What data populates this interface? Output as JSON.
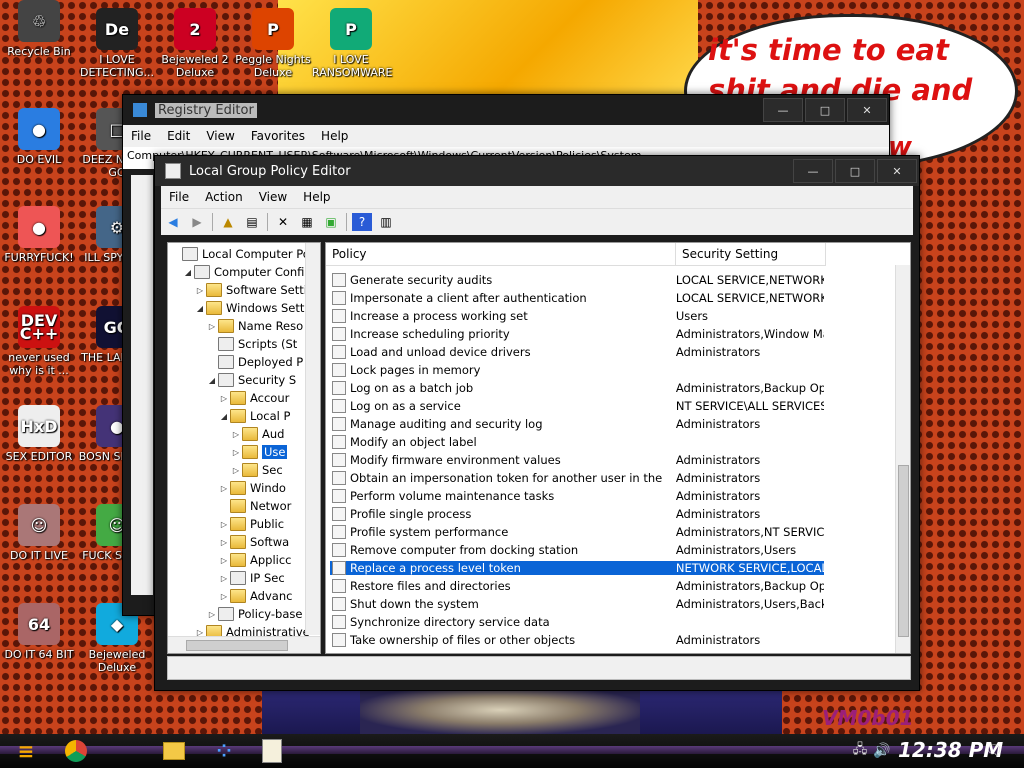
{
  "desktop": {
    "speech_text": "it's time to eat shit and die and chew",
    "speech_tail": "w",
    "logo": "VM0b01",
    "icons": [
      {
        "label": "Recycle Bin",
        "glyph": "♲",
        "color": "#444"
      },
      {
        "label": "I LOVE DETECTING...",
        "glyph": "De",
        "color": "#222"
      },
      {
        "label": "Bejeweled 2 Deluxe",
        "glyph": "2",
        "color": "#c02"
      },
      {
        "label": "Peggle Nights Deluxe",
        "glyph": "P",
        "color": "#d40"
      },
      {
        "label": "I LOVE RANSOMWARE",
        "glyph": "P",
        "color": "#1a7"
      },
      {
        "label": "DO EVIL",
        "glyph": "●",
        "color": "#2a7de1"
      },
      {
        "label": "DEEZ N HAH GO",
        "glyph": "□",
        "color": "#555"
      },
      {
        "label": "FURRYFUCK!",
        "glyph": "●",
        "color": "#e55"
      },
      {
        "label": "ILL SPY YOU",
        "glyph": "⚙",
        "color": "#468"
      },
      {
        "label": "never used why is it ...",
        "glyph": "DEV C++",
        "color": "#c11"
      },
      {
        "label": "THE LANGUA",
        "glyph": "GO",
        "color": "#113"
      },
      {
        "label": "SEX EDITOR",
        "glyph": "HxD",
        "color": "#eee"
      },
      {
        "label": "BOSN SIMULA",
        "glyph": "●",
        "color": "#437"
      },
      {
        "label": "DO IT LIVE",
        "glyph": "☺",
        "color": "#a77"
      },
      {
        "label": "FUCK S ELVE",
        "glyph": "☺",
        "color": "#4a4"
      },
      {
        "label": "DO IT 64 BIT",
        "glyph": "64",
        "color": "#a66"
      },
      {
        "label": "Bejeweled Deluxe",
        "glyph": "◆",
        "color": "#1ad"
      }
    ]
  },
  "registry": {
    "title": "Registry Editor",
    "menus": [
      "File",
      "Edit",
      "View",
      "Favorites",
      "Help"
    ],
    "address": "Computer\\HKEY_CURRENT_USER\\Software\\Microsoft\\Windows\\CurrentVersion\\Policies\\System"
  },
  "gpedit": {
    "title": "Local Group Policy Editor",
    "menus": [
      "File",
      "Action",
      "View",
      "Help"
    ],
    "tree": [
      {
        "label": "Local Computer Policy",
        "depth": 0,
        "arrow": "",
        "icon": "doc"
      },
      {
        "label": "Computer Configu",
        "depth": 1,
        "arrow": "◢",
        "icon": "doc"
      },
      {
        "label": "Software Setti",
        "depth": 2,
        "arrow": "▷",
        "icon": "folder"
      },
      {
        "label": "Windows Setti",
        "depth": 2,
        "arrow": "◢",
        "icon": "folder"
      },
      {
        "label": "Name Reso",
        "depth": 3,
        "arrow": "▷",
        "icon": "folder"
      },
      {
        "label": "Scripts (St",
        "depth": 3,
        "arrow": "",
        "icon": "doc"
      },
      {
        "label": "Deployed P",
        "depth": 3,
        "arrow": "",
        "icon": "doc"
      },
      {
        "label": "Security S",
        "depth": 3,
        "arrow": "◢",
        "icon": "doc"
      },
      {
        "label": "Accour",
        "depth": 4,
        "arrow": "▷",
        "icon": "folder"
      },
      {
        "label": "Local P",
        "depth": 4,
        "arrow": "◢",
        "icon": "folder"
      },
      {
        "label": "Aud",
        "depth": 5,
        "arrow": "▷",
        "icon": "folder"
      },
      {
        "label": "Use",
        "depth": 5,
        "arrow": "▷",
        "icon": "folder",
        "selected": true
      },
      {
        "label": "Sec",
        "depth": 5,
        "arrow": "▷",
        "icon": "folder"
      },
      {
        "label": "Windo",
        "depth": 4,
        "arrow": "▷",
        "icon": "folder"
      },
      {
        "label": "Networ",
        "depth": 4,
        "arrow": "",
        "icon": "folder"
      },
      {
        "label": "Public",
        "depth": 4,
        "arrow": "▷",
        "icon": "folder"
      },
      {
        "label": "Softwa",
        "depth": 4,
        "arrow": "▷",
        "icon": "folder"
      },
      {
        "label": "Applicc",
        "depth": 4,
        "arrow": "▷",
        "icon": "folder"
      },
      {
        "label": "IP Sec",
        "depth": 4,
        "arrow": "▷",
        "icon": "doc"
      },
      {
        "label": "Advanc",
        "depth": 4,
        "arrow": "▷",
        "icon": "folder"
      },
      {
        "label": "Policy-base",
        "depth": 3,
        "arrow": "▷",
        "icon": "doc"
      },
      {
        "label": "Administrative",
        "depth": 2,
        "arrow": "▷",
        "icon": "folder"
      }
    ],
    "columns": {
      "policy": "Policy",
      "setting": "Security Setting"
    },
    "rows": [
      {
        "policy": "Generate security audits",
        "setting": "LOCAL SERVICE,NETWORK..."
      },
      {
        "policy": "Impersonate a client after authentication",
        "setting": "LOCAL SERVICE,NETWORK..."
      },
      {
        "policy": "Increase a process working set",
        "setting": "Users"
      },
      {
        "policy": "Increase scheduling priority",
        "setting": "Administrators,Window Ma..."
      },
      {
        "policy": "Load and unload device drivers",
        "setting": "Administrators"
      },
      {
        "policy": "Lock pages in memory",
        "setting": ""
      },
      {
        "policy": "Log on as a batch job",
        "setting": "Administrators,Backup Op..."
      },
      {
        "policy": "Log on as a service",
        "setting": "NT SERVICE\\ALL SERVICES"
      },
      {
        "policy": "Manage auditing and security log",
        "setting": "Administrators"
      },
      {
        "policy": "Modify an object label",
        "setting": ""
      },
      {
        "policy": "Modify firmware environment values",
        "setting": "Administrators"
      },
      {
        "policy": "Obtain an impersonation token for another user in the same session",
        "setting": "Administrators"
      },
      {
        "policy": "Perform volume maintenance tasks",
        "setting": "Administrators"
      },
      {
        "policy": "Profile single process",
        "setting": "Administrators"
      },
      {
        "policy": "Profile system performance",
        "setting": "Administrators,NT SERVIC..."
      },
      {
        "policy": "Remove computer from docking station",
        "setting": "Administrators,Users"
      },
      {
        "policy": "Replace a process level token",
        "setting": "NETWORK SERVICE,LOCAL...",
        "selected": true
      },
      {
        "policy": "Restore files and directories",
        "setting": "Administrators,Backup Op..."
      },
      {
        "policy": "Shut down the system",
        "setting": "Administrators,Users,Back..."
      },
      {
        "policy": "Synchronize directory service data",
        "setting": ""
      },
      {
        "policy": "Take ownership of files or other objects",
        "setting": "Administrators"
      }
    ]
  },
  "taskbar": {
    "clock": "12:38 PM"
  },
  "colors": {
    "selection": "#0a64d6",
    "desktop": "#c8431c"
  }
}
